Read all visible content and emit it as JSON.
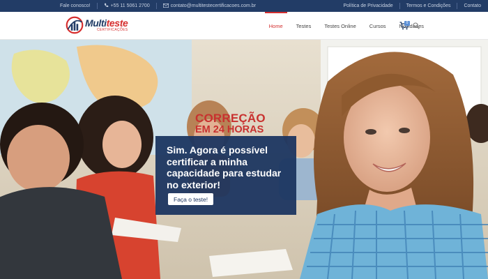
{
  "topbar": {
    "contact_label": "Fale conosco!",
    "phone": "+55 11 5061 2700",
    "email": "contato@multitestecertificacoes.com.br",
    "links": [
      "Política de Privacidade",
      "Termos e Condições",
      "Contato"
    ]
  },
  "brand": {
    "name_part1": "Multi",
    "name_part2": "teste",
    "tagline": "CERTIFICAÇÕES"
  },
  "nav": {
    "items": [
      "Home",
      "Testes",
      "Testes Online",
      "Cursos",
      "Novidades"
    ],
    "active": "Home",
    "cart_count": "0"
  },
  "hero": {
    "headline_line1": "CORREÇÃO",
    "headline_line2": "EM 24 HORAS",
    "message": "Sim. Agora é possível certificar a minha capacidade para estudar no exterior!",
    "cta_label": "Faça o teste!"
  },
  "colors": {
    "topbar_bg": "#223c66",
    "accent_red": "#d32f2f",
    "box_bg": "#1b3460",
    "badge_blue": "#5b8fd6"
  },
  "icons": [
    "phone-icon",
    "email-icon",
    "cart-icon",
    "search-icon"
  ]
}
